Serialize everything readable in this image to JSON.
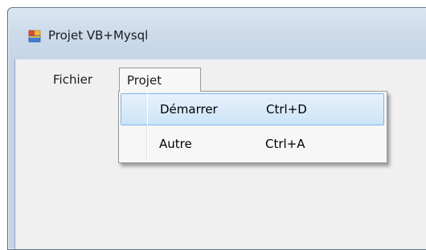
{
  "window": {
    "title": "Projet VB+Mysql",
    "icon": "app-window-icon"
  },
  "menubar": {
    "items": [
      {
        "label": "Fichier"
      },
      {
        "label": "Projet",
        "active": true
      }
    ]
  },
  "dropdown": {
    "parent": "Projet",
    "items": [
      {
        "label": "Démarrer",
        "shortcut": "Ctrl+D",
        "highlighted": true
      },
      {
        "label": "Autre",
        "shortcut": "Ctrl+A",
        "highlighted": false
      }
    ]
  },
  "colors": {
    "highlight_border": "#7eb4ea",
    "highlight_fill": "#cde4f8",
    "menu_background": "#f0f0f0",
    "titlebar": "#cddbea"
  }
}
